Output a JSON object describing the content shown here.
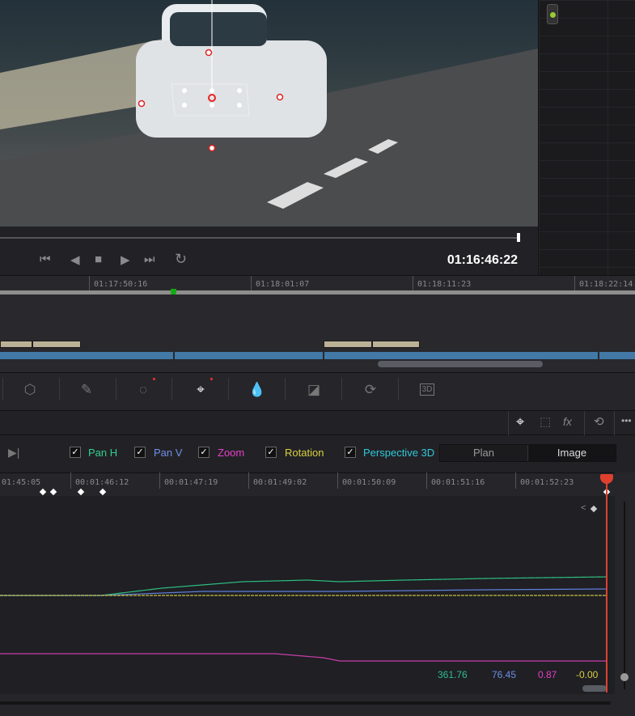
{
  "viewer": {
    "timecode": "01:16:46:22"
  },
  "transport": {
    "icons": [
      "skip-to-start-icon",
      "step-back-icon",
      "stop-icon",
      "play-icon",
      "skip-to-end-icon",
      "loop-icon"
    ]
  },
  "timeline": {
    "ruler": [
      "01:17:50:16",
      "01:18:01:07",
      "01:18:11:23",
      "01:18:22:14"
    ]
  },
  "toolbar": {
    "icons": [
      "warper-icon",
      "qualifier-eyedropper-icon",
      "window-icon",
      "tracker-icon",
      "magic-mask-icon",
      "blur-icon",
      "key-icon",
      "sizing-icon",
      "3d-icon"
    ],
    "label_3d": "3D"
  },
  "tracker": {
    "header_icons": [
      "crosshair-icon",
      "cube-icon",
      "fx-icon",
      "reset-icon",
      "more-icon"
    ],
    "fx_label": "fx",
    "more_label": "•••",
    "checkboxes": [
      {
        "label": "Pan H",
        "checked": true,
        "color": "#2fcf8f"
      },
      {
        "label": "Pan V",
        "checked": true,
        "color": "#6f8fe8"
      },
      {
        "label": "Zoom",
        "checked": true,
        "color": "#e83fc8"
      },
      {
        "label": "Rotation",
        "checked": true,
        "color": "#d8d040"
      },
      {
        "label": "Perspective 3D",
        "checked": true,
        "color": "#2fc8d8"
      }
    ],
    "mode": {
      "options": [
        "Plan",
        "Image"
      ],
      "selected": "Image"
    },
    "ruler": [
      "01:45:05",
      "00:01:46:12",
      "00:01:47:19",
      "00:01:49:02",
      "00:01:50:09",
      "00:01:51:16",
      "00:01:52:23"
    ],
    "values": {
      "pan_h": "361.76",
      "pan_v": "76.45",
      "zoom": "0.87",
      "rotation": "-0.00"
    }
  }
}
